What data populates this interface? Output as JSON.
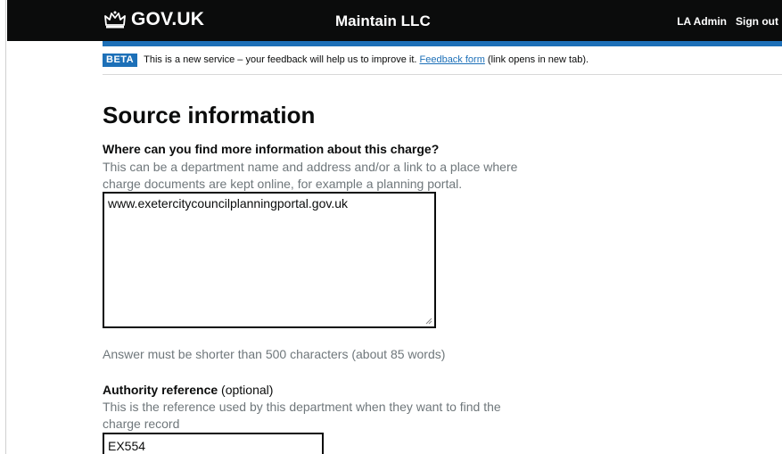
{
  "header": {
    "logo_text": "GOV.UK",
    "service_name": "Maintain LLC",
    "user_link": "LA Admin",
    "signout_link": "Sign out"
  },
  "phase_banner": {
    "tag": "BETA",
    "text_before": "This is a new service – your feedback will help us to improve it. ",
    "link_text": "Feedback form",
    "text_after": " (link opens in new tab)."
  },
  "page": {
    "title": "Source information"
  },
  "info_field": {
    "label": "Where can you find more information about this charge?",
    "hint_line1": "This can be a department name and address and/or a link to a place where",
    "hint_line2": "charge documents are kept online, for example a planning portal.",
    "value": "www.exetercitycouncilplanningportal.gov.uk",
    "char_limit_hint": "Answer must be shorter than 500 characters (about 85 words)"
  },
  "reference_field": {
    "label": "Authority reference",
    "optional": "(optional)",
    "hint_line1": "This is the reference used by this department when they want to find the",
    "hint_line2": "charge record",
    "value": "EX554"
  },
  "colors": {
    "header_bg": "#0b0c0c",
    "accent_blue": "#1d70b8",
    "hint_grey": "#6f777b"
  }
}
